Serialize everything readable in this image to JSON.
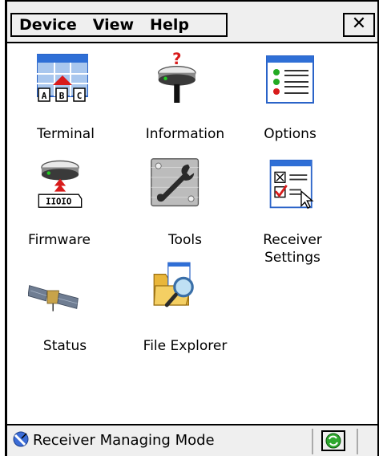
{
  "menubar": {
    "items": [
      "Device",
      "View",
      "Help"
    ],
    "close_label": "✕"
  },
  "apps": [
    {
      "label": "Terminal",
      "icon": "terminal-icon"
    },
    {
      "label": "Information",
      "icon": "information-icon"
    },
    {
      "label": "Options",
      "icon": "options-icon"
    },
    {
      "label": "Firmware",
      "icon": "firmware-icon"
    },
    {
      "label": "Tools",
      "icon": "tools-icon"
    },
    {
      "label": "Receiver",
      "label2": "Settings",
      "icon": "receiver-settings-icon"
    },
    {
      "label": "Status",
      "icon": "status-icon"
    },
    {
      "label": "File Explorer",
      "icon": "file-explorer-icon"
    }
  ],
  "statusbar": {
    "text": "Receiver Managing Mode",
    "left_icon": "satellite-dish-icon",
    "right_icon": "sync-icon"
  },
  "colors": {
    "chrome": "#efefef",
    "accent_blue": "#1e5fd0",
    "accent_red": "#d81b1b"
  }
}
